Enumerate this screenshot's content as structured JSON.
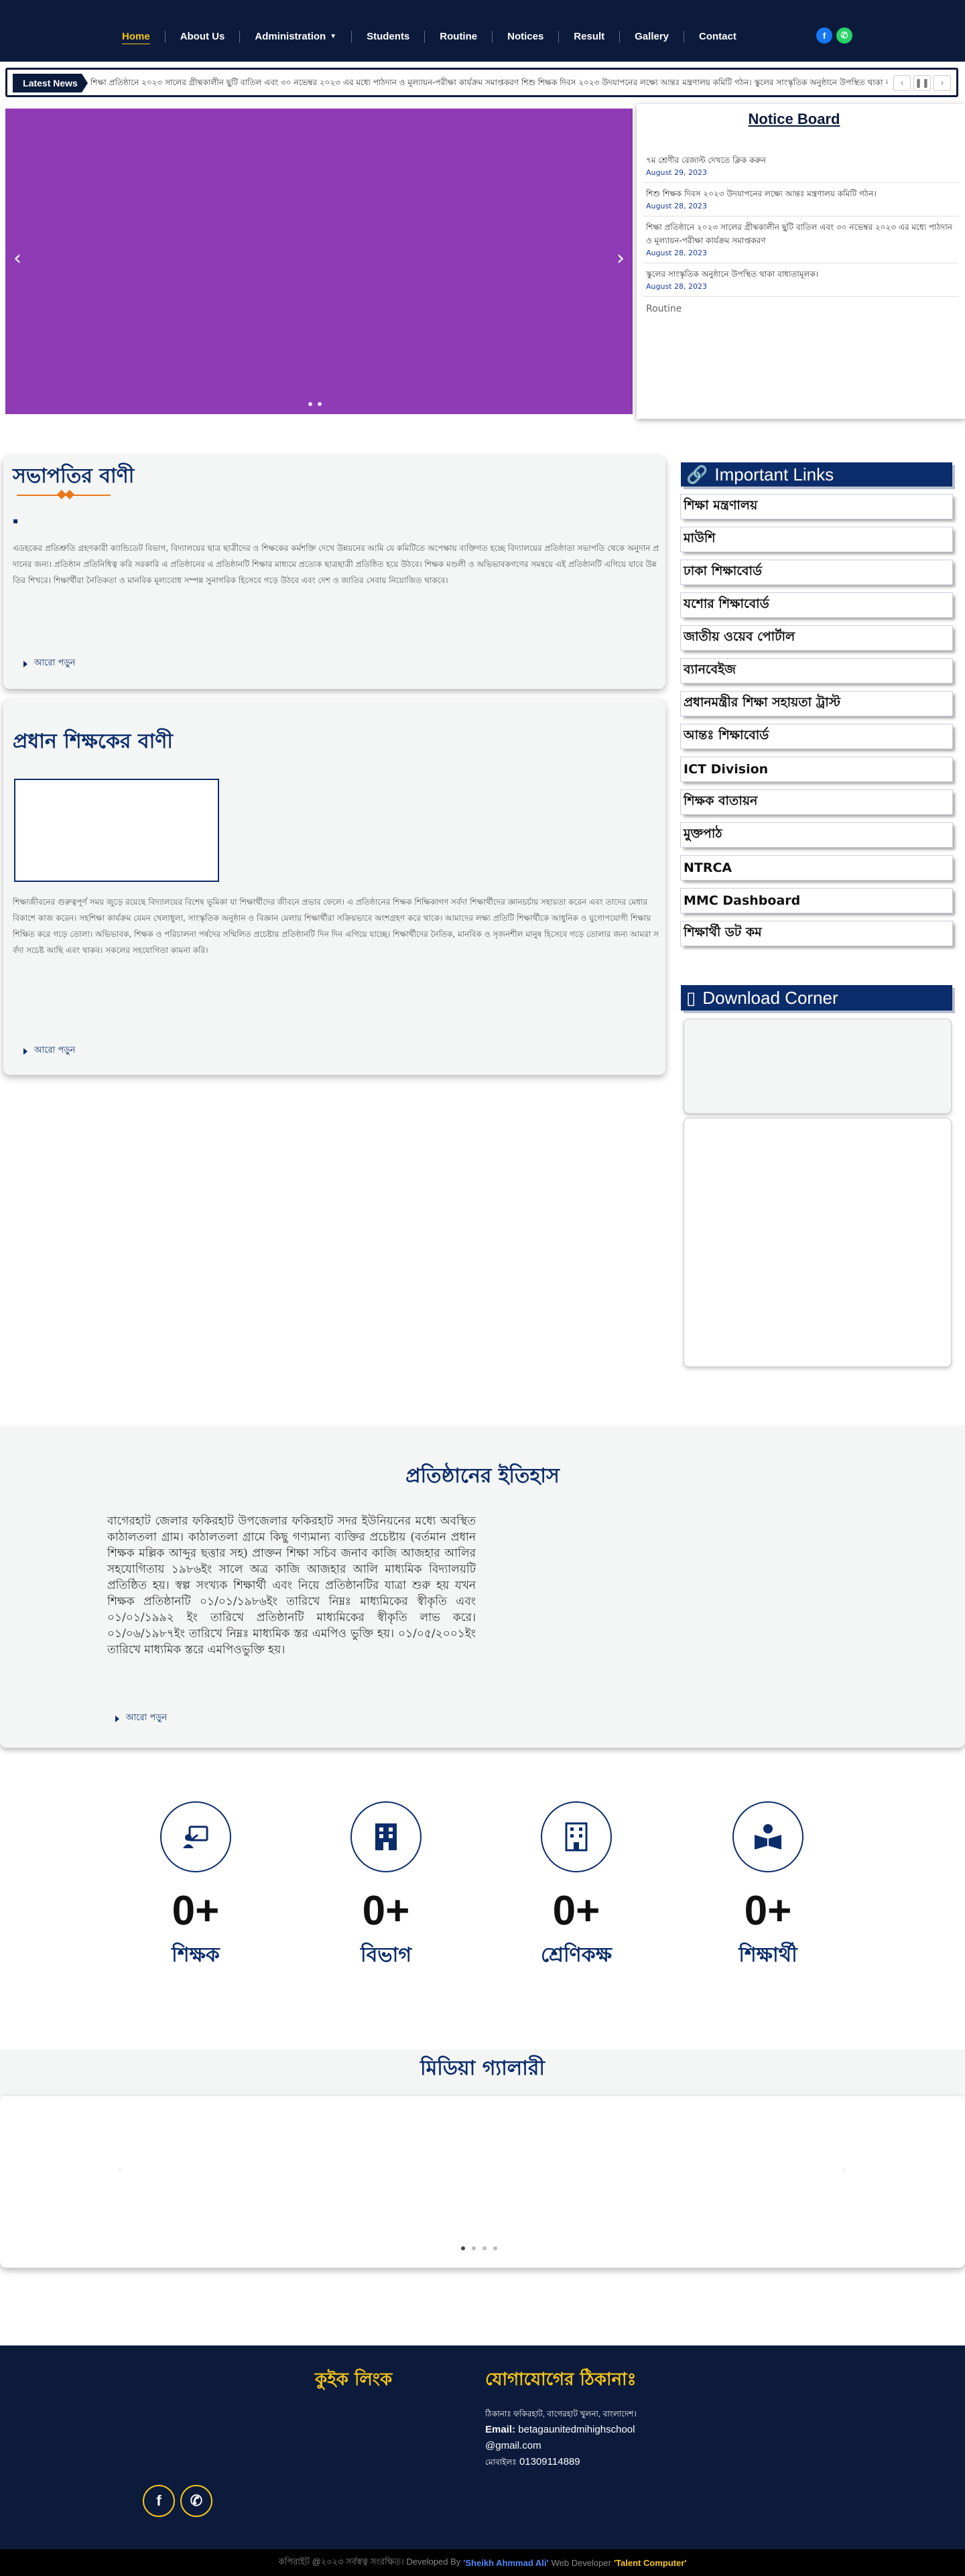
{
  "nav": {
    "items": [
      "Home",
      "About Us",
      "Administration",
      "Students",
      "Routine",
      "Notices",
      "Result",
      "Gallery",
      "Contact"
    ],
    "active": "Home"
  },
  "ticker": {
    "label": "Latest News",
    "text": "শিক্ষা প্রতিষ্ঠানে ২০২৩ সালের গ্রীষ্মকালীন ছুটি বাতিল এবং ৩০ নভেম্বর ২০২৩ এর মধ্যে পাঠদান ও মূল্যায়ন-পরীক্ষা কার্যক্রম সমাপ্তকরণ শিশু শিক্ষক দিবস ২০২৩ উদযাপনের লক্ষ্যে আন্তঃ মন্ত্রণালয় কমিটি গঠন। স্কুলের সাংস্কৃতিক অনুষ্ঠানে উপস্থিত থাকা বাধ্যতামূলক।"
  },
  "notice_board": {
    "title": "Notice Board",
    "items": [
      {
        "title": "৭ম শ্রেণীর রেজাল্ট দেখতে ক্লিক করুন",
        "date": "August 29, 2023"
      },
      {
        "title": "শিশু শিক্ষক দিবস ২০২৩ উদযাপনের লক্ষ্যে আন্তঃ মন্ত্রণালয় কমিটি গঠন।",
        "date": "August 28, 2023"
      },
      {
        "title": "শিক্ষা প্রতিষ্ঠানে ২০২৩ সালের গ্রীষ্মকালীন ছুটি বাতিল এবং ৩০ নভেম্বর ২০২৩ এর মধ্যে পাঠদান ও মূল্যায়ন-পরীক্ষা কার্যক্রম সমাপ্তকরণ",
        "date": "August 28, 2023"
      },
      {
        "title": "স্কুলের সাংস্কৃতিক অনুষ্ঠানে উপস্থিত থাকা বাধ্যতামূলক।",
        "date": "August 28, 2023"
      }
    ],
    "routine": "Routine"
  },
  "president": {
    "title": "সভাপতির বাণী",
    "bullet": "▪",
    "body": "এডহকের প্রতিশ্রুতি গ্রহণকারী ক্যান্ডিডেট বিভাগ, বিদ্যালয়ের ছাত্র ছাত্রীদের ও শিক্ষকের কর্মশক্তি দেখে উন্নয়নের আমি যে কমিটিতে অপেক্ষায় ব্যক্তিগত হচ্ছে বিদ্যালয়ের প্রতিষ্ঠাতা সভাপতি থেকে অনুদান প্রদানের জন্য। প্রতিষ্ঠান প্রতিনিধিত্ব করি সরকারি এ প্রতিষ্ঠানের এ প্রতিষ্ঠানটি শিক্ষার মাধ্যমে প্রত্যেক ছাত্রছাত্রী প্রতিষ্ঠিত হয়ে উঠবে। শিক্ষক মণ্ডলী ও অভিভাবকগণের সমন্বয়ে এই প্রতিষ্ঠানটি এগিয়ে যাবে উন্নতির শিখরে। শিক্ষার্থীরা নৈতিকতা ও মানবিক মূল্যবোধ সম্পন্ন সুনাগরিক হিসেবে গড়ে উঠবে এবং দেশ ও জাতির সেবায় নিয়োজিত থাকবে।",
    "more": "আরো পড়ুন"
  },
  "headmaster": {
    "title": "প্রধান শিক্ষকের বাণী",
    "body": "শিক্ষাজীবনের গুরুত্বপূর্ণ সময় জুড়ে রয়েছে বিদ্যালয়ের বিশেষ ভূমিকা যা শিক্ষার্থীদের জীবনে প্রভাব ফেলে। এ প্রতিষ্ঠানের শিক্ষক শিক্ষিকাগণ সর্বদা শিক্ষার্থীদের জ্ঞানচর্চায় সহায়তা করেন এবং তাদের মেধার বিকাশে কাজ করেন। সহশিক্ষা কার্যক্রম যেমন খেলাধুলা, সাংস্কৃতিক অনুষ্ঠান ও বিজ্ঞান মেলায় শিক্ষার্থীরা সক্রিয়ভাবে অংশগ্রহণ করে থাকে। আমাদের লক্ষ্য প্রতিটি শিক্ষার্থীকে আধুনিক ও যুগোপযোগী শিক্ষায় শিক্ষিত করে গড়ে তোলা। অভিভাবক, শিক্ষক ও পরিচালনা পর্ষদের সম্মিলিত প্রচেষ্টায় প্রতিষ্ঠানটি দিন দিন এগিয়ে যাচ্ছে। শিক্ষার্থীদের নৈতিক, মানবিক ও সৃজনশীল মানুষ হিসেবে গড়ে তোলার জন্য আমরা সর্বদা সচেষ্ট আছি এবং থাকব। সকলের সহযোগিতা কামনা করি।",
    "more": "আরো পড়ুন"
  },
  "important_links": {
    "title": "Important Links",
    "items": [
      "শিক্ষা মন্ত্রণালয়",
      "মাউশি",
      "ঢাকা শিক্ষাবোর্ড",
      "যশোর শিক্ষাবোর্ড",
      "জাতীয় ওয়েব পোর্টাল",
      "ব্যানবেইজ",
      "প্রধানমন্ত্রীর শিক্ষা সহায়তা ট্রাস্ট",
      "আন্তঃ শিক্ষাবোর্ড",
      "ICT Division",
      "শিক্ষক বাতায়ন",
      "মুক্তপাঠ",
      "NTRCA",
      "MMC Dashboard",
      "শিক্ষার্থী ডট কম"
    ]
  },
  "download": {
    "title": "Download Corner"
  },
  "history": {
    "title": "প্রতিষ্ঠানের ইতিহাস",
    "text": "বাগেরহাট জেলার ফকিরহাট উপজেলার ফকিরহাট সদর ইউনিয়নের মধ্যে অবস্থিত কাঠালতলা গ্রাম। কাঠালতলা গ্রামে কিছু গণ্যমান্য ব্যক্তির প্রচেষ্টায় (বর্তমান প্রধান শিক্ষক মল্লিক আব্দুর ছত্তার সহ) প্রাক্তন শিক্ষা সচিব জনাব কাজি আজহার আলির সহযোগিতায় ১৯৮৬ইং সালে অত্র কাজি আজহার আলি মাধ্যমিক বিদ্যালয়টি প্রতিষ্ঠিত হয়। স্বল্প সংখ্যক শিক্ষার্থী এবং নিয়ে প্রতিষ্ঠানটির যাত্রা শুরু হয় যখন শিক্ষক প্রতিষ্ঠানটি ০১/০১/১৯৮৬ইং তারিখে নিম্নঃ মাধ্যমিকের স্বীকৃতি এবং ০১/০১/১৯৯২ ইং তারিখে প্রতিষ্ঠানটি মাধ্যমিকের স্বীকৃতি লাভ করে। ০১/০৬/১৯৮৭ইং তারিখে নিম্নঃ মাধ্যমিক স্তর এমপিও ভুক্তি হয়। ০১/০৫/২০০১ইং তারিখে মাধ্যমিক স্তরে এমপিওভুক্তি হয়।",
    "more": "আরো পড়ুন"
  },
  "stats": [
    {
      "value": "0+",
      "label": "শিক্ষক",
      "icon": "teacher-icon"
    },
    {
      "value": "0+",
      "label": "বিভাগ",
      "icon": "building-icon"
    },
    {
      "value": "0+",
      "label": "শ্রেণিকক্ষ",
      "icon": "classroom-icon"
    },
    {
      "value": "0+",
      "label": "শিক্ষার্থী",
      "icon": "student-icon"
    }
  ],
  "gallery": {
    "title": "মিডিয়া গ্যালারী"
  },
  "footer": {
    "quick_links": "কুইক লিংক",
    "contact_title": "যোগাযোগের ঠিকানাঃ",
    "address": "ঠিকানাঃ ফকিরহাট, বাগেরহাট খুলনা, বাংলাদেশ।",
    "email_label": "Email:",
    "email": "betagaunitedmihighschool",
    "email2": "@gmail.com",
    "phone_label": "মোবাইলঃ",
    "phone": "01309114889"
  },
  "copyright": {
    "prefix": "কপিরাইট @২০২৩ সর্বস্বত্ব সংরক্ষিত। Developed By",
    "developer": "'Sheikh Ahmmad Ali'",
    "middle": "Web Developer",
    "company": "'Talent Computer'"
  },
  "colors": {
    "navy": "#0c1b3c",
    "accent": "#f5c518",
    "slider": "#8e3bb5",
    "heading": "#0c2d6b"
  }
}
